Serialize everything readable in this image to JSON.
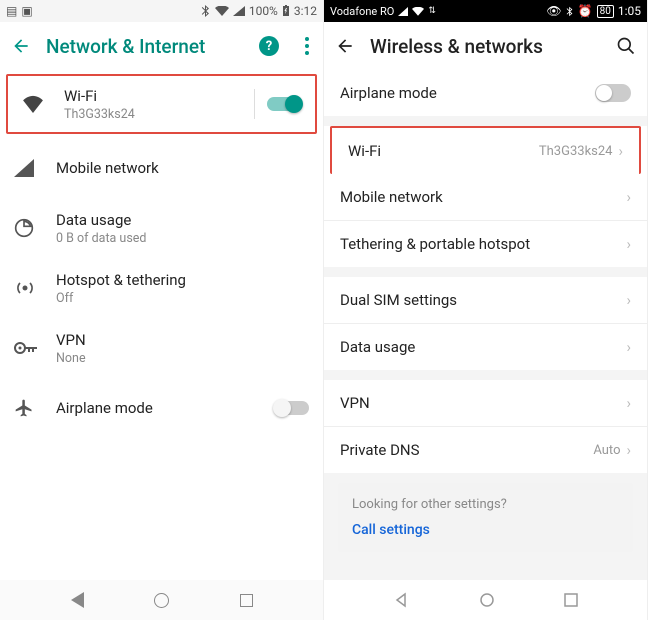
{
  "left": {
    "status": {
      "battery": "100%",
      "time": "3:12"
    },
    "title": "Network & Internet",
    "wifi": {
      "label": "Wi-Fi",
      "ssid": "Th3G33ks24"
    },
    "mobile": {
      "label": "Mobile network"
    },
    "datausage": {
      "label": "Data usage",
      "sub": "0 B of data used"
    },
    "hotspot": {
      "label": "Hotspot & tethering",
      "sub": "Off"
    },
    "vpn": {
      "label": "VPN",
      "sub": "None"
    },
    "airplane": {
      "label": "Airplane mode"
    }
  },
  "right": {
    "status": {
      "carrier": "Vodafone RO",
      "battery": "80",
      "time": "1:05"
    },
    "title": "Wireless & networks",
    "airplane": {
      "label": "Airplane mode"
    },
    "wifi": {
      "label": "Wi-Fi",
      "value": "Th3G33ks24"
    },
    "mobile": {
      "label": "Mobile network"
    },
    "tether": {
      "label": "Tethering & portable hotspot"
    },
    "dualsim": {
      "label": "Dual SIM settings"
    },
    "datausage": {
      "label": "Data usage"
    },
    "vpn": {
      "label": "VPN"
    },
    "dns": {
      "label": "Private DNS",
      "value": "Auto"
    },
    "footer": {
      "q": "Looking for other settings?",
      "link": "Call settings"
    }
  }
}
